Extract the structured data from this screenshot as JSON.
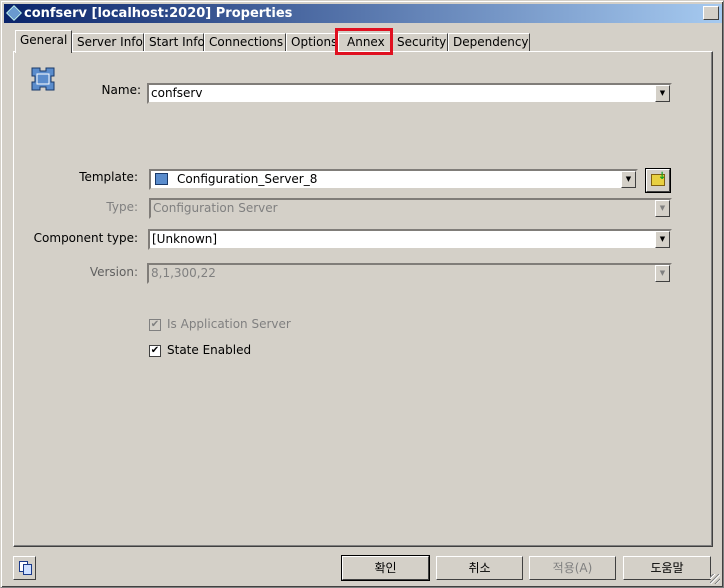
{
  "window": {
    "title": "confserv [localhost:2020] Properties"
  },
  "tabs": [
    {
      "label": "General",
      "selected": true
    },
    {
      "label": "Server Info"
    },
    {
      "label": "Start Info"
    },
    {
      "label": "Connections"
    },
    {
      "label": "Options"
    },
    {
      "label": "Annex",
      "highlighted": true
    },
    {
      "label": "Security"
    },
    {
      "label": "Dependency"
    }
  ],
  "form": {
    "name": {
      "label": "Name:",
      "value": "confserv"
    },
    "template": {
      "label": "Template:",
      "value": "Configuration_Server_8"
    },
    "type": {
      "label": "Type:",
      "value": "Configuration Server",
      "disabled": true
    },
    "component_type": {
      "label": "Component type:",
      "value": "[Unknown]"
    },
    "version": {
      "label": "Version:",
      "value": "8,1,300,22",
      "disabled": true
    },
    "is_app_server": {
      "label": "Is Application Server",
      "checked": true,
      "disabled": true
    },
    "state_enabled": {
      "label": "State Enabled",
      "checked": true
    }
  },
  "buttons": {
    "ok": "확인",
    "cancel": "취소",
    "apply": "적용(A)",
    "help": "도움말"
  },
  "colors": {
    "highlight": "#e01020",
    "title_start": "#0a246a",
    "title_end": "#a6caf0"
  }
}
